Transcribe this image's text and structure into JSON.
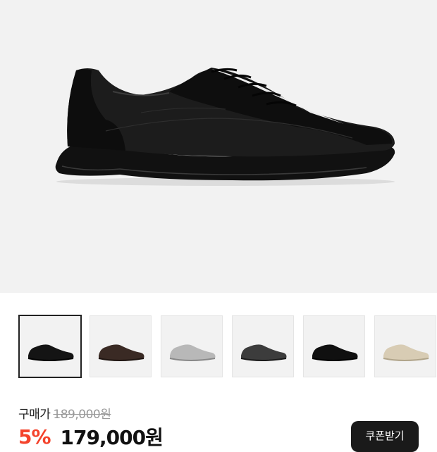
{
  "gallery": {
    "main_image": "black-leather-sneaker",
    "thumbnails": [
      {
        "name": "black-leather",
        "color": "#141414",
        "selected": true
      },
      {
        "name": "brown-leather",
        "color": "#3a2a24",
        "selected": false
      },
      {
        "name": "silver-leather",
        "color": "#b8b8b8",
        "selected": false
      },
      {
        "name": "dark-grey-leather",
        "color": "#3c3c3c",
        "selected": false
      },
      {
        "name": "black-suede",
        "color": "#101010",
        "selected": false
      },
      {
        "name": "beige-leather",
        "color": "#d8ccb4",
        "selected": false
      }
    ]
  },
  "price": {
    "label": "구매가",
    "original": "189,000원",
    "discount": "5%",
    "sale": "179,000원"
  },
  "coupon": {
    "label": "쿠폰받기"
  },
  "colors": {
    "discount_accent": "#f4432c",
    "button_bg": "#1a1a1a"
  }
}
